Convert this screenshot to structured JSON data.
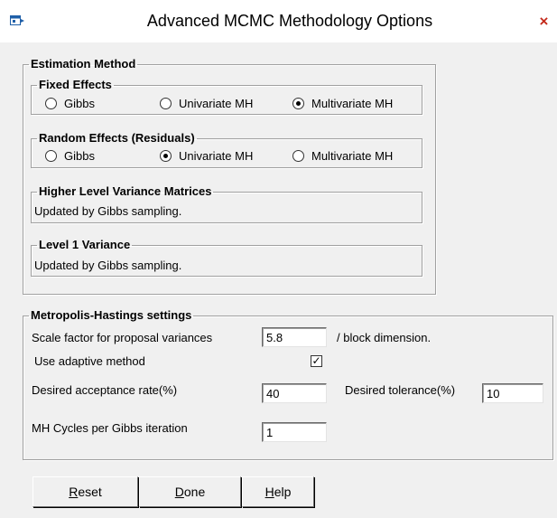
{
  "window": {
    "title": "Advanced MCMC Methodology Options",
    "close_glyph": "×",
    "app_icon": "app-window-icon"
  },
  "estimation": {
    "legend": "Estimation Method",
    "fixed_effects": {
      "legend": "Fixed Effects",
      "options": [
        "Gibbs",
        "Univariate MH",
        "Multivariate MH"
      ],
      "selected": "Multivariate MH"
    },
    "random_effects": {
      "legend": "Random Effects (Residuals)",
      "options": [
        "Gibbs",
        "Univariate MH",
        "Multivariate MH"
      ],
      "selected": "Univariate MH"
    },
    "higher_level": {
      "legend": "Higher Level  Variance Matrices",
      "text": "Updated by Gibbs sampling."
    },
    "level1": {
      "legend": "Level 1 Variance",
      "text": "Updated by Gibbs sampling."
    }
  },
  "mh": {
    "legend": "Metropolis-Hastings settings",
    "scale_label": "Scale factor for proposal variances",
    "scale_value": "5.8",
    "scale_suffix": "/ block dimension.",
    "adaptive_label": "Use adaptive method",
    "adaptive_checked": true,
    "acceptance_label": "Desired acceptance rate(%)",
    "acceptance_value": "40",
    "tolerance_label": "Desired tolerance(%)",
    "tolerance_value": "10",
    "cycles_label": "MH Cycles per Gibbs iteration",
    "cycles_value": "1"
  },
  "buttons": {
    "reset": {
      "first": "R",
      "rest": "eset"
    },
    "done": {
      "first": "D",
      "rest": "one"
    },
    "help": {
      "first": "H",
      "rest": "elp"
    }
  },
  "colors": {
    "close": "#c42b1c",
    "face": "#f0f0f0"
  }
}
